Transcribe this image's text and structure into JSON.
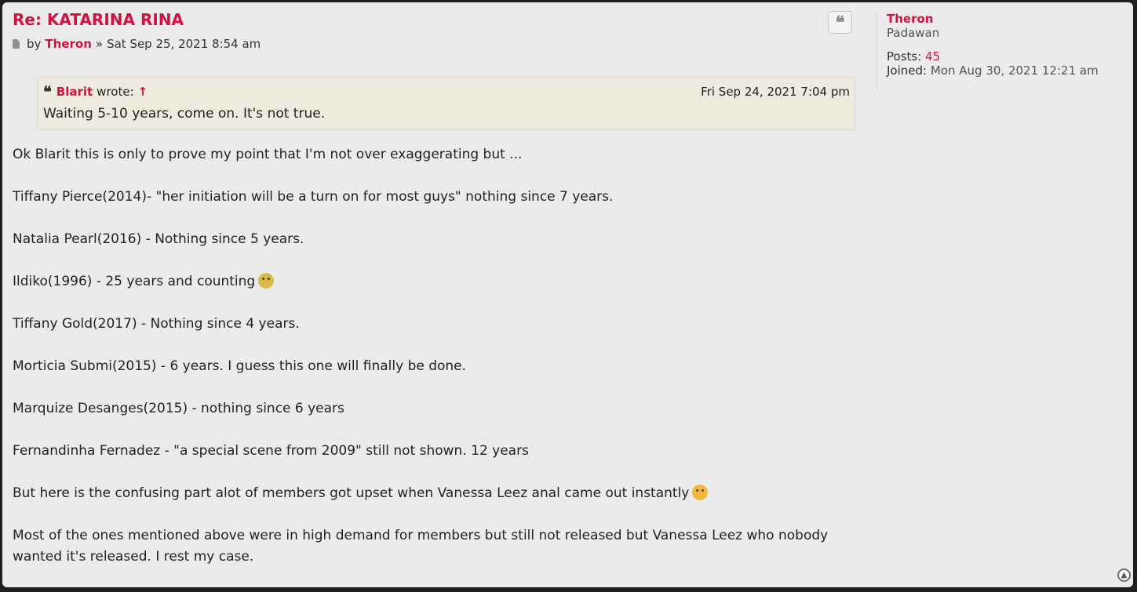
{
  "post": {
    "title": "Re: KATARINA RINA",
    "by": "by",
    "author": "Theron",
    "separator": "»",
    "date": "Sat Sep 25, 2021 8:54 am",
    "quote_button_icon": "quote-icon"
  },
  "quote": {
    "author": "Blarit",
    "wrote": "wrote:",
    "arrow": "↑",
    "date": "Fri Sep 24, 2021 7:04 pm",
    "text": "Waiting 5-10 years, come on. It's not true."
  },
  "body": {
    "p1": "Ok Blarit this is only to prove my point that I'm not over exaggerating but ...",
    "p2": "Tiffany Pierce(2014)- \"her initiation will be a turn on for most guys\" nothing since 7 years.",
    "p3": "Natalia Pearl(2016) - Nothing since 5 years.",
    "p4": "Ildiko(1996) - 25 years and counting",
    "p5": "Tiffany Gold(2017) - Nothing since 4 years.",
    "p6": "Morticia Submi(2015) - 6 years. I guess this one will finally be done.",
    "p7": "Marquize Desanges(2015) - nothing since 6 years",
    "p8": "Fernandinha Fernadez - \"a special scene from 2009\" still not shown. 12 years",
    "p9": "But here is the confusing part alot of members got upset when Vanessa Leez anal came out instantly",
    "p10": "Most of the ones mentioned above were in high demand for members but still not released but Vanessa Leez who nobody wanted it's released. I rest my case."
  },
  "profile": {
    "username": "Theron",
    "rank": "Padawan",
    "posts_label": "Posts:",
    "posts_value": "45",
    "joined_label": "Joined:",
    "joined_value": "Mon Aug 30, 2021 12:21 am"
  },
  "colors": {
    "accent": "#d31141",
    "post_bg": "#ebebeb",
    "quote_bg": "#ecebdd"
  }
}
